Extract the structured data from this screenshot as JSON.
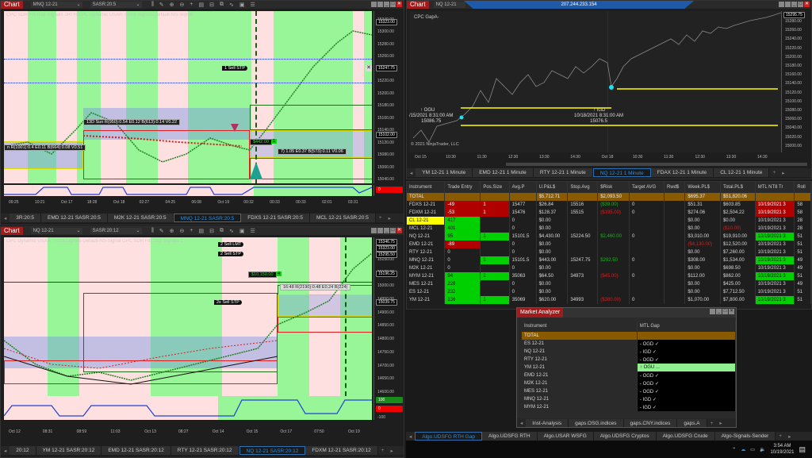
{
  "top_left_chart": {
    "chart_button": "Chart",
    "instrument": "MNQ 12-21",
    "template": "SASR:20:5",
    "indicator_label": "CPC SDR Fib Gap Signals-1RTH   CPC Dynamic USAR Trend Signals-Default-NS-Signal",
    "price_ticks": [
      "15340.00",
      "15300.00",
      "15280.00",
      "15260.00",
      "15240.00",
      "15220.00",
      "15200.00",
      "15180.00",
      "15160.00",
      "15140.00",
      "15120.00",
      "15080.00",
      "15060.00",
      "15040.00"
    ],
    "price_tags": [
      {
        "label": "15323.00"
      },
      {
        "label": "15247.75"
      },
      {
        "label": "15102.00"
      }
    ],
    "oscillator_value": "0",
    "time_ticks": [
      "09:25",
      "10:21",
      "Oct 17",
      "18:28",
      "Oct 18",
      "02:27",
      "04:25",
      "06:08",
      "Oct 19",
      "00:32",
      "00:33",
      "00:33",
      "02:01",
      "03:31"
    ],
    "order_label": "1  Sell STP",
    "position_pnl": "$442.00",
    "position_qty": "1",
    "stat_label_1": "13D Sun R(950):0.54 E0.12 B(613):0.14 V0.22",
    "stat_label_2": "n R(1001):0.4 E0.11 B(664):0.08 V0.51",
    "stat_label_3": "7) 1.05 E0.37 B(573):0.11 V0.06",
    "tabs": [
      {
        "label": "3R:20:5"
      },
      {
        "label": "EMD 12-21 SASR:20:5"
      },
      {
        "label": "M2K 12-21 SASR:20:5"
      },
      {
        "label": "MNQ 12-21 SASR:20:5",
        "active": true
      },
      {
        "label": "FDXS 12-21 SASR:20:5"
      },
      {
        "label": "MCL 12-21 SASR:20:5"
      }
    ]
  },
  "bottom_left_chart": {
    "chart_button": "Chart",
    "instrument": "NQ 12-21",
    "template": "SASR:20:12",
    "indicator_label": "CPC Dynamic USAR Trend Signals-Default-NS-Signal   CPC SDR Fib Gap Signals-2",
    "price_ticks": [
      "15250.00",
      "15150.00",
      "15100.00",
      "15000.00",
      "14950.00",
      "14900.00",
      "14850.00",
      "14800.00",
      "14750.00",
      "14700.00",
      "14650.00",
      "14600.00"
    ],
    "price_tags": [
      {
        "label": "15346.75"
      },
      {
        "label": "15323.00"
      },
      {
        "label": "15295.50"
      },
      {
        "label": "15196.25"
      },
      {
        "label": "15039.75"
      }
    ],
    "osc_top": "100",
    "osc_value": "0",
    "osc_bottom": "-100",
    "time_ticks": [
      "Oct 12",
      "08:31",
      "08:59",
      "11:03",
      "Oct 13",
      "08:27",
      "Oct 14",
      "Oct 15",
      "Oct 17",
      "07:50",
      "Oct 19"
    ],
    "orders": [
      {
        "label": "2  Sell LMT"
      },
      {
        "label": "2  Sell STP"
      },
      {
        "label": "2s  Sell STP"
      }
    ],
    "position_pnl": "$10,150.00",
    "position_qty": "4",
    "stat_label": "16:48 R(2190):0.48 E0.24 B(224)",
    "tabs": [
      {
        "label": "20:12"
      },
      {
        "label": "YM 12-21 SASR:20:12"
      },
      {
        "label": "EMD 12-21 SASR:20:12"
      },
      {
        "label": "RTY 12-21 SASR:20:12"
      },
      {
        "label": "NQ 12-21 SASR:20:12",
        "active": true
      },
      {
        "label": "FDXM 12-21 SASR:20:12"
      }
    ]
  },
  "top_right_chart": {
    "chart_button": "Chart",
    "instrument": "NQ 12-21",
    "remote_ip": "207.244.233.154",
    "indicator_label": "CPC GapA-",
    "price_ticks": [
      "15280.00",
      "15260.00",
      "15240.00",
      "15220.00",
      "15200.00",
      "15180.00",
      "15160.00",
      "15140.00",
      "15120.00",
      "15100.00",
      "15080.00",
      "15060.00",
      "15040.00",
      "15020.00",
      "15000.00"
    ],
    "last_price": "15295.75",
    "annotation_1": {
      "arrow": "↑ OGU",
      "time": "/15/2021 8:31:00 AM",
      "price": "15086.75"
    },
    "annotation_2": {
      "arrow": "↑ IGD",
      "time": "10/18/2021 8:31:00 AM",
      "price": "15076.5"
    },
    "copyright": "© 2021 NinjaTrader, LLC",
    "time_ticks": [
      "Oct 15",
      "10:30",
      "11:30",
      "12:30",
      "13:30",
      "14:30",
      "Oct 18",
      "10:30",
      "11:30",
      "12:30",
      "13:30",
      "14:30"
    ],
    "tabs": [
      {
        "label": "YM 12-21 1 Minute"
      },
      {
        "label": "EMD 12-21 1 Minute"
      },
      {
        "label": "RTY 12-21 1 Minute"
      },
      {
        "label": "NQ 12-21 1 Minute",
        "active": true
      },
      {
        "label": "FDAX 12-21 1 Minute"
      },
      {
        "label": "CL 12-21 1 Minute"
      }
    ]
  },
  "accounts_grid": {
    "columns": [
      "Instrument",
      "Trade Entry",
      "Pos.Size",
      "Avg.P",
      "U.P&L$",
      "Stop.Avg",
      "$Risk",
      "Target AVG",
      "Rwd$",
      "Week.PL$",
      "Total.PL$",
      "MTL NT8 Tr",
      "Roll"
    ],
    "total": {
      "instrument": "TOTAL",
      "upl": "$5,712.71",
      "risk": "$2,093.50",
      "week": "$695.37",
      "totalpl": "$51,820.06"
    },
    "rows": [
      {
        "instrument": "FDXS 12-21",
        "entry": "-49",
        "entry_style": "red",
        "pos": "1",
        "pos_style": "red",
        "avg": "15477",
        "upl": "$26.84",
        "stop": "15516",
        "risk": "($39.00)",
        "risk_style": "txtgrn",
        "target": "0",
        "week": "$51.31",
        "totalpl": "$603.85",
        "mtl": "10/19/2021 3",
        "mtl_style": "red",
        "roll": "58"
      },
      {
        "instrument": "FDXM 12-21",
        "entry": "-53",
        "entry_style": "red",
        "pos": "1",
        "pos_style": "red",
        "avg": "15476",
        "upl": "$128.37",
        "stop": "15515",
        "risk": "($195.00)",
        "risk_style": "txtred",
        "target": "0",
        "week": "$274.06",
        "totalpl": "$2,504.22",
        "mtl": "10/19/2021 3",
        "mtl_style": "red",
        "roll": "58"
      },
      {
        "instrument": "CL 12-21",
        "inst_style": "yel",
        "entry": "417",
        "entry_style": "grn",
        "pos": "",
        "avg": "0",
        "upl": "$0.00",
        "stop": "",
        "risk": "",
        "target": "",
        "week": "$0.00",
        "totalpl": "$0.00",
        "mtl": "10/19/2021 3",
        "roll": "28"
      },
      {
        "instrument": "MCL 12-21",
        "entry": "401",
        "entry_style": "grn",
        "pos": "",
        "avg": "0",
        "upl": "$0.00",
        "stop": "",
        "risk": "",
        "target": "",
        "week": "$0.00",
        "totalpl": "($10.00)",
        "totalpl_style": "txtred",
        "mtl": "10/19/2021 3",
        "roll": "28"
      },
      {
        "instrument": "NQ 12-21",
        "entry": "95",
        "entry_style": "grn",
        "pos": "1",
        "pos_style": "grn",
        "avg": "15101.5",
        "upl": "$4,430.00",
        "stop": "15224.50",
        "risk": "$2,460.00",
        "risk_style": "txtgrn",
        "target": "0",
        "week": "$3,010.00",
        "totalpl": "$19,910.00",
        "mtl": "10/19/2021 3",
        "mtl_style": "grn",
        "roll": "51"
      },
      {
        "instrument": "EMD 12-21",
        "entry": "-89",
        "entry_style": "red",
        "pos": "",
        "avg": "0",
        "upl": "$0.00",
        "stop": "",
        "risk": "",
        "target": "",
        "week": "($4,130.00)",
        "week_style": "txtred",
        "totalpl": "$12,520.00",
        "mtl": "10/19/2021 3",
        "roll": "51"
      },
      {
        "instrument": "RTY 12-21",
        "entry": "0",
        "pos": "",
        "avg": "0",
        "upl": "$0.00",
        "stop": "",
        "risk": "",
        "target": "",
        "week": "$0.00",
        "totalpl": "$7,260.00",
        "mtl": "10/19/2021 3",
        "roll": "51"
      },
      {
        "instrument": "MNQ 12-21",
        "entry": "0",
        "pos": "1",
        "pos_style": "grn",
        "avg": "15101.5",
        "upl": "$443.00",
        "stop": "15247.75",
        "risk": "$292.50",
        "risk_style": "txtgrn",
        "target": "0",
        "week": "$308.00",
        "totalpl": "$1,534.00",
        "mtl": "10/19/2021 3",
        "mtl_style": "grn",
        "roll": "49"
      },
      {
        "instrument": "M2K 12-21",
        "entry": "0",
        "pos": "",
        "avg": "0",
        "upl": "$0.00",
        "stop": "",
        "risk": "",
        "target": "",
        "week": "$0.00",
        "totalpl": "$698.50",
        "mtl": "10/19/2021 3",
        "roll": "49"
      },
      {
        "instrument": "MYM 12-21",
        "entry": "94",
        "entry_style": "grn",
        "pos": "1",
        "pos_style": "grn",
        "avg": "35063",
        "upl": "$64.50",
        "stop": "34973",
        "risk": "($45.00)",
        "risk_style": "txtred",
        "target": "0",
        "week": "$112.00",
        "totalpl": "$862.00",
        "mtl": "10/19/2021 3",
        "mtl_style": "grn",
        "roll": "51"
      },
      {
        "instrument": "MES 12-21",
        "entry": "228",
        "entry_style": "grn",
        "pos": "",
        "avg": "0",
        "upl": "$0.00",
        "stop": "",
        "risk": "",
        "target": "",
        "week": "$0.00",
        "totalpl": "$425.00",
        "mtl": "10/19/2021 3",
        "roll": "49"
      },
      {
        "instrument": "ES 12-21",
        "entry": "232",
        "entry_style": "grn",
        "pos": "",
        "avg": "0",
        "upl": "$0.00",
        "stop": "",
        "risk": "",
        "target": "",
        "week": "$0.00",
        "totalpl": "$7,712.50",
        "mtl": "10/19/2021 3",
        "roll": "51"
      },
      {
        "instrument": "YM 12-21",
        "entry": "136",
        "entry_style": "grn",
        "pos": "1",
        "pos_style": "grn",
        "avg": "35069",
        "upl": "$620.00",
        "stop": "34993",
        "risk": "($380.00)",
        "risk_style": "txtred",
        "target": "0",
        "week": "$1,070.00",
        "totalpl": "$7,800.00",
        "mtl": "10/19/2021 3",
        "mtl_style": "grn",
        "roll": "51"
      }
    ]
  },
  "market_analyzer": {
    "title": "Market Analyzer",
    "columns": [
      "Instrument",
      "MTL Gap"
    ],
    "total": "TOTAL",
    "rows": [
      {
        "instrument": "ES 12-21",
        "gap": "- OGD ✓"
      },
      {
        "instrument": "NQ 12-21",
        "gap": "- IGD ✓"
      },
      {
        "instrument": "RTY 12-21",
        "gap": "- OGD ✓"
      },
      {
        "instrument": "YM 12-21",
        "gap": "↑ OGU ...",
        "highlight": true
      },
      {
        "instrument": "EMD 12-21",
        "gap": "- OGD ✓"
      },
      {
        "instrument": "M2K 12-21",
        "gap": "- OGD ✓"
      },
      {
        "instrument": "MES 12-21",
        "gap": "- OGD ✓"
      },
      {
        "instrument": "MNQ 12-21",
        "gap": "- IGD ✓"
      },
      {
        "instrument": "MYM 12-21",
        "gap": "- IGD ✓"
      }
    ],
    "tabs": [
      {
        "label": "Inst-Analysis"
      },
      {
        "label": "gaps.OSG.indices"
      },
      {
        "label": "gaps.CNY.indices"
      },
      {
        "label": "gaps.A"
      }
    ]
  },
  "workspace_tabs": [
    {
      "label": "Algo.UDSFG RTH Gap",
      "active": true
    },
    {
      "label": "Algo.UDSFG RTH"
    },
    {
      "label": "Algo.USAR WSFG"
    },
    {
      "label": "Algo.UDSFG Cryptos"
    },
    {
      "label": "Algo.UDSFG Crude"
    },
    {
      "label": "Algo-Signals-Sender"
    }
  ],
  "taskbar": {
    "time": "3:54 AM",
    "date": "10/19/2021"
  },
  "colors": {
    "chart_red": "#a01c1c",
    "bull_band": "#98f598",
    "bear_band": "#ffe0e0",
    "accent_blue": "#2a8fe0",
    "total_row": "#8a5a00",
    "yellow": "#ffff00"
  }
}
